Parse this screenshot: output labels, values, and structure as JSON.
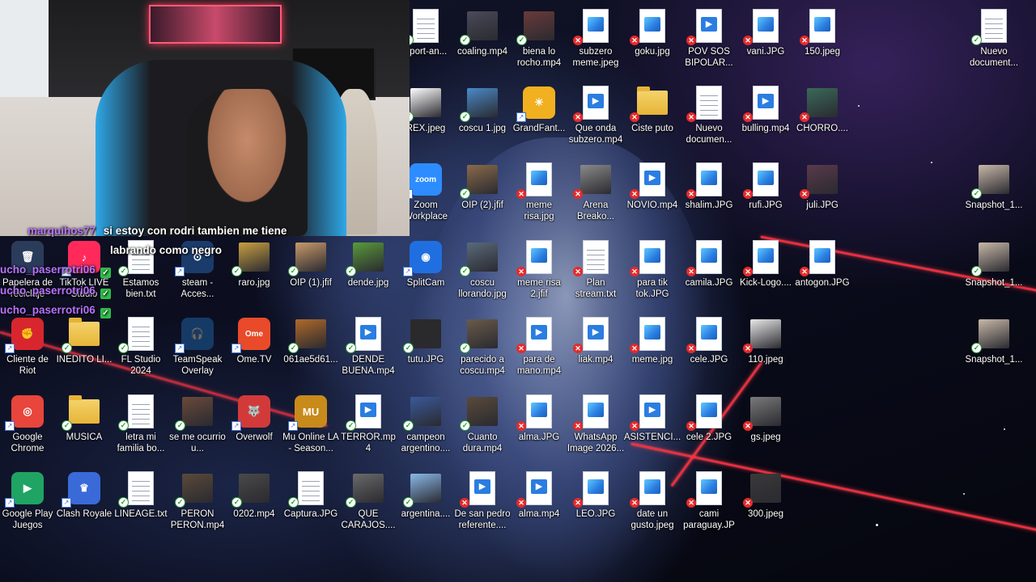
{
  "chat": [
    {
      "user": "marquihos77",
      "message": "si estoy con rodri tambien me tiene"
    },
    {
      "user": "",
      "message": "labrando como negro"
    },
    {
      "user": "ucho_paserrotri06",
      "message": ""
    },
    {
      "user": "ucho_paserrotri06",
      "message": ""
    },
    {
      "user": "ucho_paserrotri06",
      "message": ""
    }
  ],
  "icons": [
    {
      "label": "Papelera de reciclaje",
      "kind": "app",
      "glyph": "🗑",
      "color": "#2b3b5a",
      "status": "none"
    },
    {
      "label": "TikTok LIVE Studio",
      "kind": "app",
      "glyph": "♪",
      "color": "#ff2a5a",
      "status": "shortcut"
    },
    {
      "label": "Estamos bien.txt",
      "kind": "txt",
      "status": "ok"
    },
    {
      "label": "steam - Acces...",
      "kind": "app",
      "glyph": "⊙",
      "color": "#1b3b6a",
      "status": "shortcut"
    },
    {
      "label": "raro.jpg",
      "kind": "photo",
      "color": "#c8a040",
      "status": "ok"
    },
    {
      "label": "OIP (1).jfif",
      "kind": "photo",
      "color": "#c89a6a",
      "status": "ok"
    },
    {
      "label": "dende.jpg",
      "kind": "photo",
      "color": "#5a9a3a",
      "status": "ok"
    },
    {
      "label": "SplitCam",
      "kind": "app",
      "glyph": "◉",
      "color": "#1f6fe0",
      "status": "shortcut"
    },
    {
      "label": "Cliente de Riot",
      "kind": "app",
      "glyph": "✊",
      "color": "#d8262e",
      "status": "shortcut"
    },
    {
      "label": "INEDITO LI...",
      "kind": "folder",
      "status": "ok"
    },
    {
      "label": "FL Studio 2024",
      "kind": "txt",
      "status": "ok"
    },
    {
      "label": "TeamSpeak Overlay",
      "kind": "app",
      "glyph": "🎧",
      "color": "#163a66",
      "status": "shortcut"
    },
    {
      "label": "Ome.TV",
      "kind": "app",
      "glyph": "Ome",
      "color": "#e84a2a",
      "status": "shortcut"
    },
    {
      "label": "061ae5d61...",
      "kind": "photo",
      "color": "#b06a2a",
      "status": "ok"
    },
    {
      "label": "DENDE BUENA.mp4",
      "kind": "video",
      "status": "ok"
    },
    {
      "label": "tutu.JPG",
      "kind": "photo",
      "color": "#2a2a2a",
      "status": "ok"
    },
    {
      "label": "Google Chrome",
      "kind": "app",
      "glyph": "◎",
      "color": "#e8453c",
      "status": "shortcut"
    },
    {
      "label": "MUSICA",
      "kind": "folder",
      "status": "ok"
    },
    {
      "label": "letra mi familia bo...",
      "kind": "txt",
      "status": "ok"
    },
    {
      "label": "se me ocurrio u...",
      "kind": "photo",
      "color": "#6a4a3a",
      "status": "ok"
    },
    {
      "label": "Overwolf",
      "kind": "app",
      "glyph": "🐺",
      "color": "#d23a3a",
      "status": "shortcut"
    },
    {
      "label": "Mu Online LA - Season...",
      "kind": "app",
      "glyph": "MU",
      "color": "#c88a1a",
      "status": "shortcut"
    },
    {
      "label": "TERROR.mp4",
      "kind": "video",
      "status": "ok"
    },
    {
      "label": "campeon argentino....",
      "kind": "photo",
      "color": "#3a5a9a",
      "status": "ok"
    },
    {
      "label": "Google Play Juegos",
      "kind": "app",
      "glyph": "▶",
      "color": "#1fa463",
      "status": "shortcut"
    },
    {
      "label": "Clash Royale",
      "kind": "app",
      "glyph": "♛",
      "color": "#3a6ad8",
      "status": "shortcut"
    },
    {
      "label": "LINEAGE.txt",
      "kind": "txt",
      "status": "ok"
    },
    {
      "label": "PERON PERON.mp4",
      "kind": "photo",
      "color": "#5a4a3a",
      "status": "ok"
    },
    {
      "label": "0202.mp4",
      "kind": "photo",
      "color": "#4a4a4a",
      "status": "ok"
    },
    {
      "label": "Captura.JPG",
      "kind": "txt",
      "status": "ok"
    },
    {
      "label": "QUE CARAJOS....",
      "kind": "photo",
      "color": "#6a6a6a",
      "status": "ok"
    },
    {
      "label": "argentina....",
      "kind": "photo",
      "color": "#8ab8e8",
      "status": "ok"
    },
    {
      "label": "pport-an...",
      "kind": "txt",
      "status": "ok"
    },
    {
      "label": "coaling.mp4",
      "kind": "photo",
      "color": "#4a4a5a",
      "status": "ok"
    },
    {
      "label": "biena lo rocho.mp4",
      "kind": "photo",
      "color": "#6a3a3a",
      "status": "ok"
    },
    {
      "label": "subzero meme.jpeg",
      "kind": "image",
      "status": "err"
    },
    {
      "label": "goku.jpg",
      "kind": "image",
      "status": "err"
    },
    {
      "label": "POV SOS BIPOLAR...",
      "kind": "video",
      "status": "err"
    },
    {
      "label": "vani.JPG",
      "kind": "image",
      "status": "err"
    },
    {
      "label": "150.jpeg",
      "kind": "image",
      "status": "err"
    },
    {
      "label": "Nuevo document...",
      "kind": "txt",
      "status": "ok"
    },
    {
      "label": "REX.jpeg",
      "kind": "photo",
      "color": "#ffffff",
      "status": "ok"
    },
    {
      "label": "coscu 1.jpg",
      "kind": "photo",
      "color": "#4a8ac8",
      "status": "ok"
    },
    {
      "label": "GrandFant...",
      "kind": "app",
      "glyph": "☀",
      "color": "#f0b020",
      "status": "shortcut"
    },
    {
      "label": "Que onda subzero.mp4",
      "kind": "video",
      "status": "err"
    },
    {
      "label": "Ciste puto",
      "kind": "folder",
      "status": "err"
    },
    {
      "label": "Nuevo documen...",
      "kind": "txt",
      "status": "err"
    },
    {
      "label": "bulling.mp4",
      "kind": "video",
      "status": "err"
    },
    {
      "label": "CHORRO....",
      "kind": "photo",
      "color": "#3a6a5a",
      "status": "err"
    },
    {
      "label": "Zoom Workplace",
      "kind": "app",
      "glyph": "zoom",
      "color": "#2d8cff",
      "status": "shortcut"
    },
    {
      "label": "OIP (2).jfif",
      "kind": "photo",
      "color": "#8a6a4a",
      "status": "ok"
    },
    {
      "label": "meme risa.jpg",
      "kind": "image",
      "status": "err"
    },
    {
      "label": "Arena Breako...",
      "kind": "photo",
      "color": "#8a8a8a",
      "status": "err"
    },
    {
      "label": "NOVIO.mp4",
      "kind": "video",
      "status": "err"
    },
    {
      "label": "shalim.JPG",
      "kind": "image",
      "status": "err"
    },
    {
      "label": "rufi.JPG",
      "kind": "image",
      "status": "err"
    },
    {
      "label": "juli.JPG",
      "kind": "photo",
      "color": "#5a3a4a",
      "status": "err"
    },
    {
      "label": "Snapshot_1...",
      "kind": "photo",
      "color": "#c8b8a8",
      "status": "ok"
    },
    {
      "label": "coscu llorando.jpg",
      "kind": "photo",
      "color": "#5a6a7a",
      "status": "ok"
    },
    {
      "label": "meme risa 2.jfif",
      "kind": "image",
      "status": "err"
    },
    {
      "label": "Plan stream.txt",
      "kind": "txt",
      "status": "err"
    },
    {
      "label": "para tik tok.JPG",
      "kind": "image",
      "status": "err"
    },
    {
      "label": "camila.JPG",
      "kind": "image",
      "status": "err"
    },
    {
      "label": "Kick-Logo....",
      "kind": "image",
      "status": "err"
    },
    {
      "label": "antogon.JPG",
      "kind": "image",
      "status": "err"
    },
    {
      "label": "Snapshot_1...",
      "kind": "photo",
      "color": "#c8b8a8",
      "status": "ok"
    },
    {
      "label": "parecido a coscu.mp4",
      "kind": "photo",
      "color": "#6a5a4a",
      "status": "ok"
    },
    {
      "label": "para de mano.mp4",
      "kind": "video",
      "status": "err"
    },
    {
      "label": "liak.mp4",
      "kind": "video",
      "status": "err"
    },
    {
      "label": "meme.jpg",
      "kind": "image",
      "status": "err"
    },
    {
      "label": "cele.JPG",
      "kind": "image",
      "status": "err"
    },
    {
      "label": "110.jpeg",
      "kind": "photo",
      "color": "#e8e8e8",
      "status": "err"
    },
    {
      "label": "Snapshot_1...",
      "kind": "photo",
      "color": "#c8b8a8",
      "status": "ok"
    },
    {
      "label": "Cuanto dura.mp4",
      "kind": "photo",
      "color": "#5a4a3a",
      "status": "ok"
    },
    {
      "label": "alma.JPG",
      "kind": "image",
      "status": "err"
    },
    {
      "label": "WhatsApp Image 2026...",
      "kind": "image",
      "status": "err"
    },
    {
      "label": "ASISTENCI...",
      "kind": "video",
      "status": "err"
    },
    {
      "label": "cele 2.JPG",
      "kind": "image",
      "status": "err"
    },
    {
      "label": "gs.jpeg",
      "kind": "photo",
      "color": "#7a7a7a",
      "status": "err"
    },
    {
      "label": "De san pedro referente....",
      "kind": "video",
      "status": "err"
    },
    {
      "label": "alma.mp4",
      "kind": "video",
      "status": "err"
    },
    {
      "label": "LEO.JPG",
      "kind": "image",
      "status": "err"
    },
    {
      "label": "date un gusto.jpeg",
      "kind": "image",
      "status": "err"
    },
    {
      "label": "cami paraguay.JPG",
      "kind": "image",
      "status": "err"
    },
    {
      "label": "300.jpeg",
      "kind": "photo",
      "color": "#3a3a3a",
      "status": "err"
    }
  ]
}
